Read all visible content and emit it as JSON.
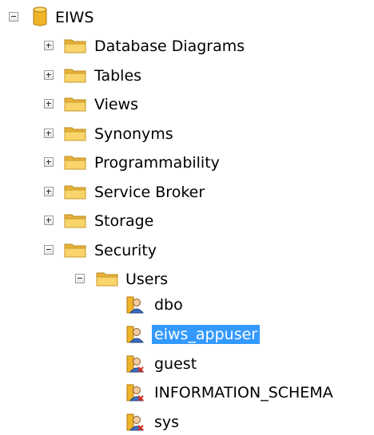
{
  "tree": {
    "database": {
      "label": "EIWS",
      "icon": "database-icon",
      "expanded": true
    },
    "folders": [
      {
        "label": "Database Diagrams",
        "icon": "folder-icon",
        "expanded": false
      },
      {
        "label": "Tables",
        "icon": "folder-icon",
        "expanded": false
      },
      {
        "label": "Views",
        "icon": "folder-icon",
        "expanded": false
      },
      {
        "label": "Synonyms",
        "icon": "folder-icon",
        "expanded": false
      },
      {
        "label": "Programmability",
        "icon": "folder-icon",
        "expanded": false
      },
      {
        "label": "Service Broker",
        "icon": "folder-icon",
        "expanded": false
      },
      {
        "label": "Storage",
        "icon": "folder-icon",
        "expanded": false
      },
      {
        "label": "Security",
        "icon": "folder-icon",
        "expanded": true
      }
    ],
    "users_folder": {
      "label": "Users",
      "icon": "folder-icon",
      "expanded": true
    },
    "users": [
      {
        "label": "dbo",
        "icon": "user-icon",
        "selected": false
      },
      {
        "label": "eiws_appuser",
        "icon": "user-icon",
        "selected": true
      },
      {
        "label": "guest",
        "icon": "user-disabled-icon",
        "selected": false
      },
      {
        "label": "INFORMATION_SCHEMA",
        "icon": "user-disabled-icon",
        "selected": false
      },
      {
        "label": "sys",
        "icon": "user-disabled-icon",
        "selected": false
      }
    ],
    "colors": {
      "selection": "#3399ff",
      "folder": "#f5c94c",
      "database": "#f0b429",
      "user_disabled_marker": "#d62d20"
    }
  }
}
